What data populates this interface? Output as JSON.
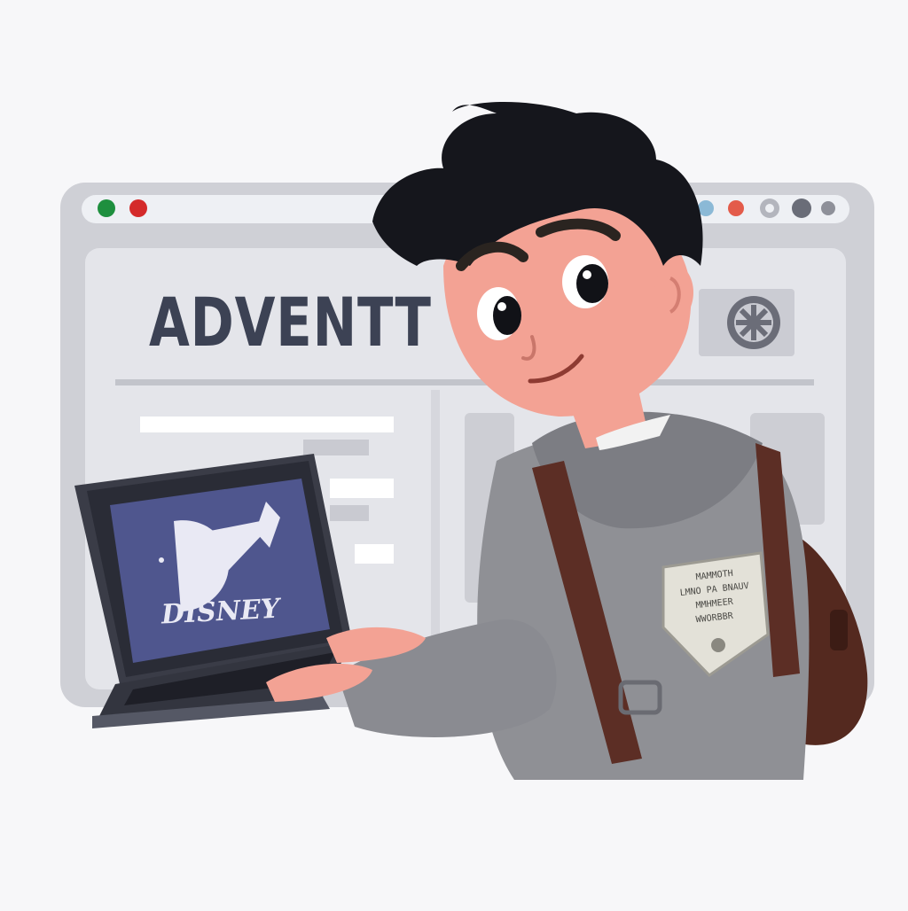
{
  "window": {
    "headline": "ADVENTT",
    "dots_left": [
      "#1e8f3e",
      "#d42a2a"
    ],
    "dots_right": [
      "#8bb9d6",
      "#e35b4a",
      "#b3b5bd",
      "#6a6d78",
      "#8e9099"
    ]
  },
  "laptop": {
    "screen_logo": "DISNEY",
    "screen_color": "#4f568e"
  },
  "person": {
    "hair_color": "#15161c",
    "hoodie_color": "#8f9095",
    "strap_color": "#5c2e25",
    "badge_text": [
      "MAMMOTH",
      "LMNO PA BNAUV",
      "MMHMEER",
      "WWORBBR"
    ]
  }
}
